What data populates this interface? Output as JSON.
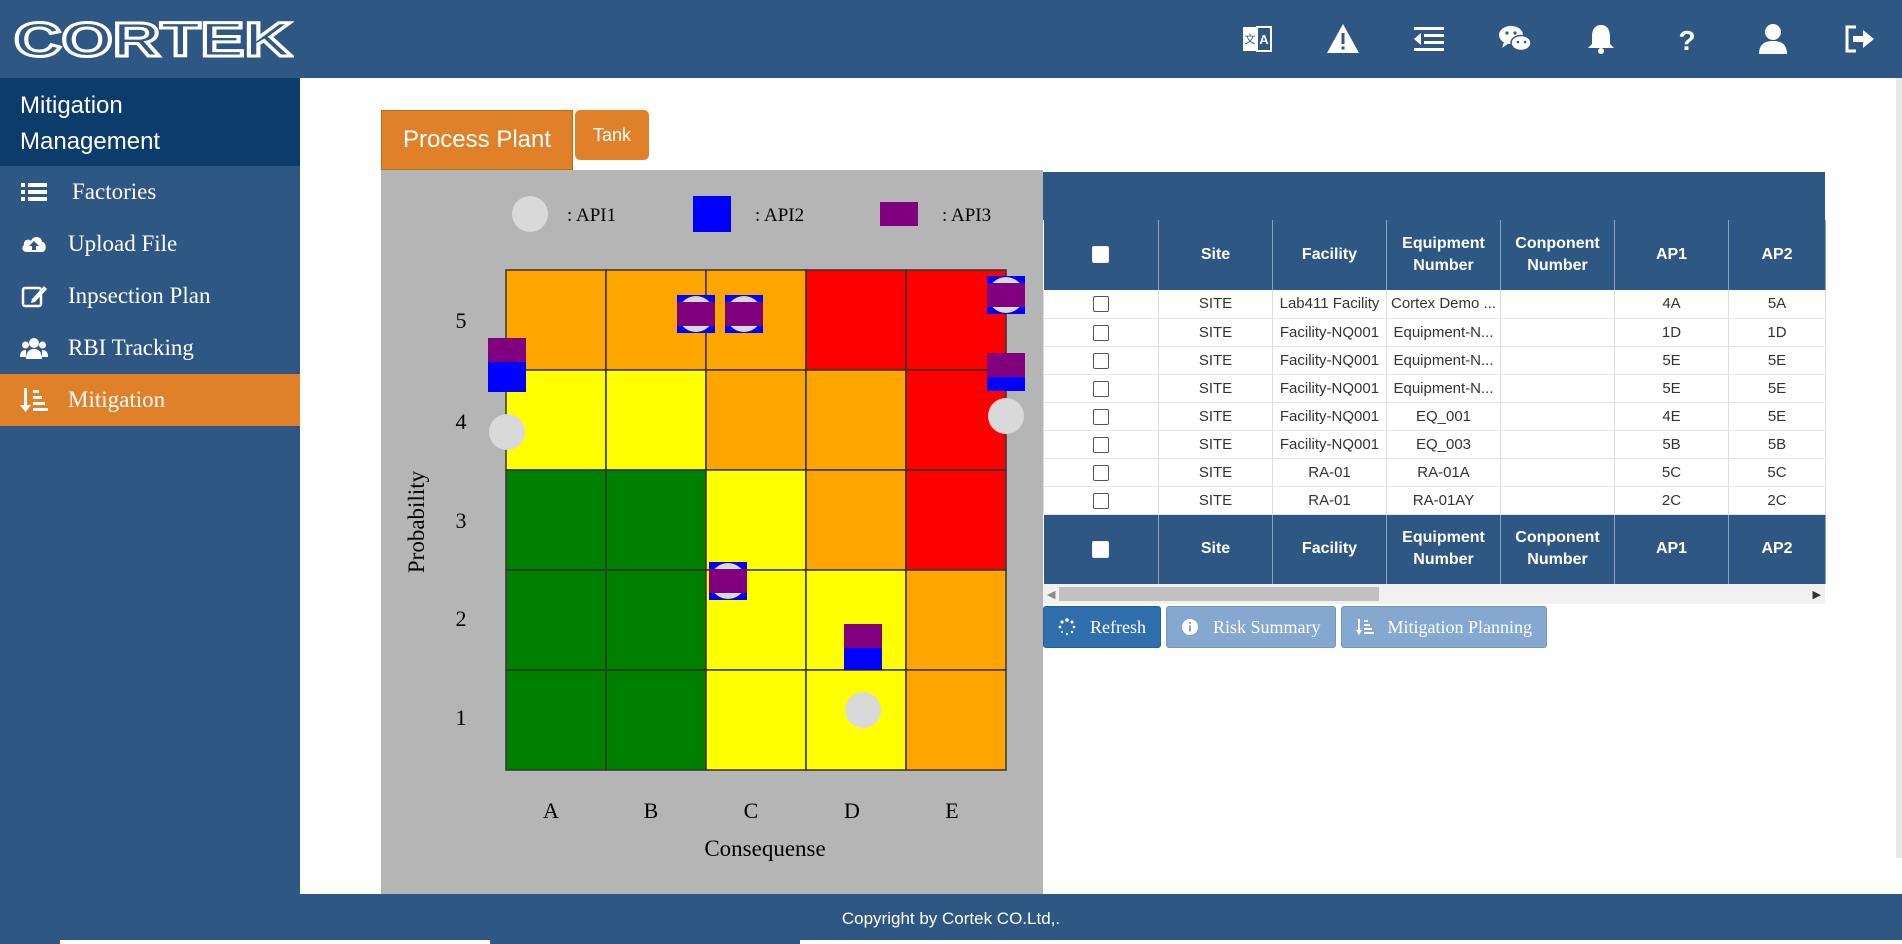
{
  "header": {
    "logo_text": "CORTEK",
    "icons": [
      "translate-icon",
      "warning-icon",
      "menu-collapse-icon",
      "wechat-icon",
      "bell-icon",
      "help-icon",
      "user-icon",
      "logout-icon"
    ]
  },
  "sidebar": {
    "title_line1": "Mitigation",
    "title_line2": "Management",
    "items": [
      {
        "label": "Factories",
        "icon": "list-icon"
      },
      {
        "label": "Upload File",
        "icon": "cloud-upload-icon"
      },
      {
        "label": "Inpsection Plan",
        "icon": "edit-icon"
      },
      {
        "label": "RBI Tracking",
        "icon": "users-icon"
      },
      {
        "label": "Mitigation",
        "icon": "sort-amount-icon",
        "active": true
      }
    ]
  },
  "tabs": {
    "process_plant": "Process Plant",
    "tank": "Tank"
  },
  "matrix": {
    "legend": {
      "api1": ": API1",
      "api2": ": API2",
      "api3": ": API3"
    },
    "y_axis_label": "Probability",
    "x_axis_label": "Consequense",
    "x_ticks": [
      "A",
      "B",
      "C",
      "D",
      "E"
    ],
    "y_ticks": [
      "5",
      "4",
      "3",
      "2",
      "1"
    ],
    "colors": {
      "green": "#008000",
      "yellow": "#ffff00",
      "orange": "#ffa500",
      "red": "#ff0000",
      "api1": "#d9d9d9",
      "api2": "#0000ff",
      "api3": "#800080"
    },
    "rows": [
      [
        "orange",
        "orange",
        "orange",
        "red",
        "red"
      ],
      [
        "yellow",
        "yellow",
        "orange",
        "orange",
        "red"
      ],
      [
        "green",
        "green",
        "yellow",
        "orange",
        "red"
      ],
      [
        "green",
        "green",
        "yellow",
        "yellow",
        "orange"
      ],
      [
        "green",
        "green",
        "yellow",
        "yellow",
        "orange"
      ]
    ]
  },
  "table": {
    "headers": [
      "",
      "Site",
      "Facility",
      "Equipment Number",
      "Conponent Number",
      "AP1",
      "AP2"
    ],
    "rows": [
      [
        "SITE",
        "Lab411 Facility",
        "Cortex Demo ...",
        "",
        "4A",
        "5A"
      ],
      [
        "SITE",
        "Facility-NQ001",
        "Equipment-N...",
        "",
        "1D",
        "1D"
      ],
      [
        "SITE",
        "Facility-NQ001",
        "Equipment-N...",
        "",
        "5E",
        "5E"
      ],
      [
        "SITE",
        "Facility-NQ001",
        "Equipment-N...",
        "",
        "5E",
        "5E"
      ],
      [
        "SITE",
        "Facility-NQ001",
        "EQ_001",
        "",
        "4E",
        "5E"
      ],
      [
        "SITE",
        "Facility-NQ001",
        "EQ_003",
        "",
        "5B",
        "5B"
      ],
      [
        "SITE",
        "RA-01",
        "RA-01A",
        "",
        "5C",
        "5C"
      ],
      [
        "SITE",
        "RA-01",
        "RA-01AY",
        "",
        "2C",
        "2C"
      ]
    ]
  },
  "buttons": {
    "refresh": "Refresh",
    "risk_summary": "Risk Summary",
    "mitigation_planning": "Mitigation Planning"
  },
  "footer": {
    "copyright": "Copyright by Cortek CO.Ltd,."
  }
}
